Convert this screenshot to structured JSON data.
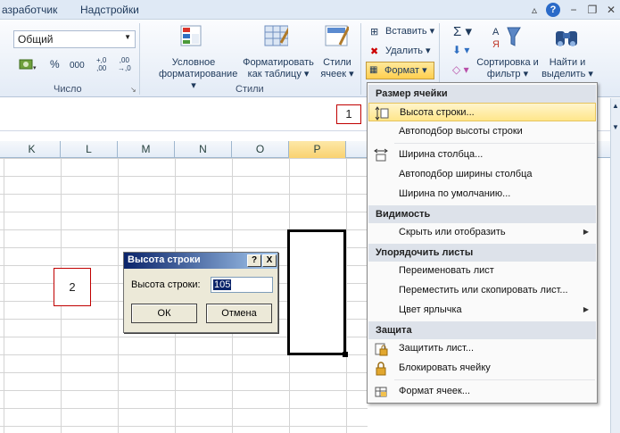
{
  "tabs": [
    "азработчик",
    "Надстройки"
  ],
  "window_buttons": {
    "help": "?",
    "minimize": "−",
    "restore": "❐",
    "close": "✕"
  },
  "ribbon": {
    "number_format_value": "Общий",
    "number_group_label": "Число",
    "percent": "%",
    "thousands": "000",
    "inc_decimal": "+,0\n,00",
    "dec_decimal": ",00\n→,0",
    "styles_group_label": "Стили",
    "cond_format": "Условное форматирование ▾",
    "format_as_table": "Форматировать как таблицу ▾",
    "cell_styles": "Стили ячеек ▾",
    "insert": "Вставить ▾",
    "delete": "Удалить ▾",
    "format": "Формат ▾",
    "sort_filter": "Сортировка и фильтр ▾",
    "find_select": "Найти и выделить ▾"
  },
  "columns": [
    "K",
    "L",
    "M",
    "N",
    "O",
    "P"
  ],
  "callouts": {
    "one": "1",
    "two": "2"
  },
  "menu": {
    "section_size": "Размер ячейки",
    "row_height": "Высота строки...",
    "autofit_row": "Автоподбор высоты строки",
    "col_width": "Ширина столбца...",
    "autofit_col": "Автоподбор ширины столбца",
    "default_width": "Ширина по умолчанию...",
    "section_visibility": "Видимость",
    "hide_show": "Скрыть или отобразить",
    "section_order": "Упорядочить листы",
    "rename": "Переименовать лист",
    "move_copy": "Переместить или скопировать лист...",
    "tab_color": "Цвет ярлычка",
    "section_protect": "Защита",
    "protect_sheet": "Защитить лист...",
    "lock_cell": "Блокировать ячейку",
    "format_cells": "Формат ячеек..."
  },
  "dialog": {
    "title": "Высота строки",
    "help_btn": "?",
    "close_btn": "X",
    "label": "Высота строки:",
    "value": "105",
    "ok": "ОК",
    "cancel": "Отмена"
  },
  "colors": {
    "accent": "#ffe68a",
    "callout_border": "#c00000",
    "dialog_title": "#0a246a"
  }
}
